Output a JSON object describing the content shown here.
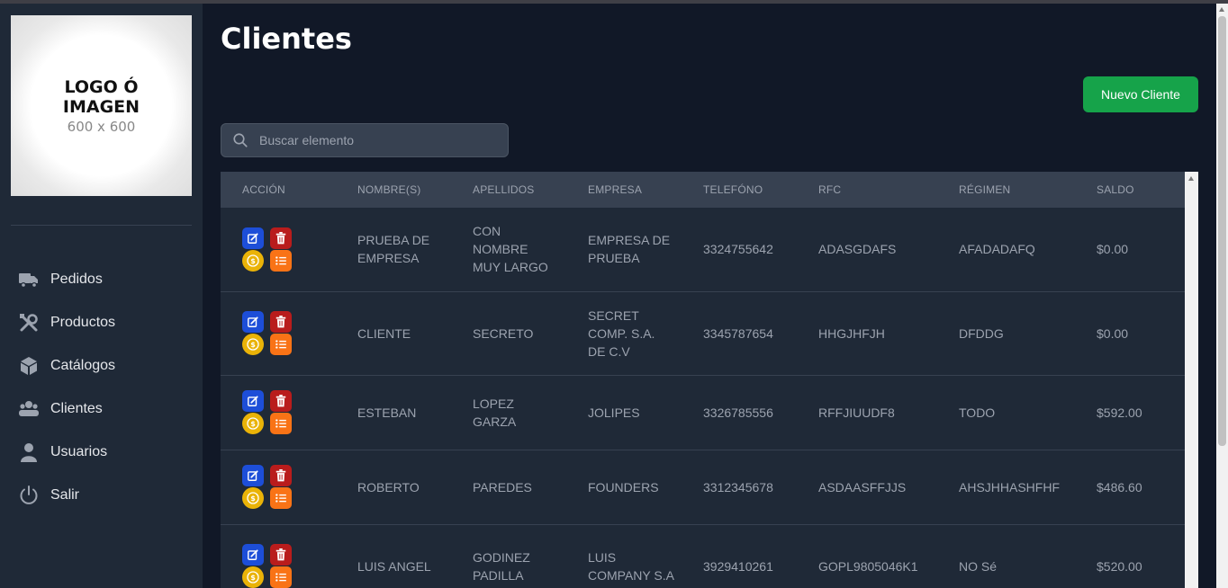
{
  "logo": {
    "title_line1": "LOGO Ó",
    "title_line2": "IMAGEN",
    "size": "600 x 600"
  },
  "sidebar": {
    "items": [
      {
        "label": "Pedidos",
        "icon": "truck-icon"
      },
      {
        "label": "Productos",
        "icon": "tools-icon"
      },
      {
        "label": "Catálogos",
        "icon": "cube-icon"
      },
      {
        "label": "Clientes",
        "icon": "users-icon"
      },
      {
        "label": "Usuarios",
        "icon": "user-icon"
      },
      {
        "label": "Salir",
        "icon": "power-icon"
      }
    ]
  },
  "page": {
    "title": "Clientes",
    "new_button": "Nuevo Cliente"
  },
  "search": {
    "placeholder": "Buscar elemento"
  },
  "table": {
    "headers": [
      "ACCIÓN",
      "NOMBRE(S)",
      "APELLIDOS",
      "EMPRESA",
      "TELEFÓNO",
      "RFC",
      "RÉGIMEN",
      "SALDO"
    ],
    "rows": [
      {
        "nombre": "PRUEBA DE EMPRESA",
        "apellidos": "CON NOMBRE MUY LARGO",
        "empresa": "EMPRESA DE PRUEBA",
        "telefono": "3324755642",
        "rfc": "ADASGDAFS",
        "regimen": "AFADADAFQ",
        "saldo": "$0.00"
      },
      {
        "nombre": "CLIENTE",
        "apellidos": "SECRETO",
        "empresa": "SECRET COMP. S.A. DE C.V",
        "telefono": "3345787654",
        "rfc": "HHGJHFJH",
        "regimen": "DFDDG",
        "saldo": "$0.00"
      },
      {
        "nombre": "ESTEBAN",
        "apellidos": "LOPEZ GARZA",
        "empresa": "JOLIPES",
        "telefono": "3326785556",
        "rfc": "RFFJIUUDF8",
        "regimen": "TODO",
        "saldo": "$592.00"
      },
      {
        "nombre": "ROBERTO",
        "apellidos": "PAREDES",
        "empresa": "FOUNDERS",
        "telefono": "3312345678",
        "rfc": "ASDAASFFJJS",
        "regimen": "AHSJHHASHFHF",
        "saldo": "$486.60"
      },
      {
        "nombre": "LUIS ANGEL",
        "apellidos": "GODINEZ PADILLA",
        "empresa": "LUIS COMPANY S.A",
        "telefono": "3929410261",
        "rfc": "GOPL9805046K1",
        "regimen": "NO Sé",
        "saldo": "$520.00"
      }
    ]
  },
  "colors": {
    "sidebar_bg": "#1f2937",
    "page_bg": "#111827",
    "primary_green": "#16a34a",
    "edit_blue": "#1d4ed8",
    "delete_red": "#b91c1c",
    "pay_yellow": "#eab308",
    "list_orange": "#f97316"
  }
}
